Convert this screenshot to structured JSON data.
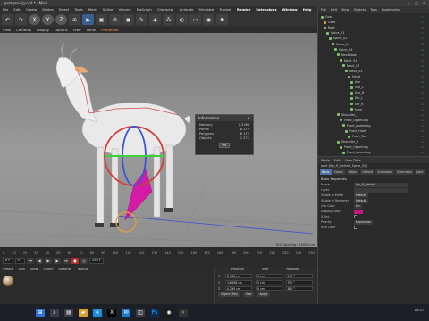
{
  "window": {
    "title": "goat-pro-rig.c4d * - Main"
  },
  "menubar": [
    "File",
    "Edit",
    "Create",
    "Modes",
    "Select",
    "Tools",
    "Mesh",
    "Spline",
    "Volume",
    "MoGraph",
    "Character",
    "Animate",
    "Simulate",
    "Tracker",
    "Render",
    "Extensions",
    "Window",
    "Help"
  ],
  "toolbar": {
    "axis_labels": [
      "X",
      "Y",
      "Z"
    ]
  },
  "viewport_menu": {
    "items": [
      "View",
      "Cameras",
      "Display",
      "Options",
      "Filter",
      "Panel",
      "ProRender"
    ],
    "active": "ProRender"
  },
  "viewport": {
    "grid_spacing": "Grid Spacing : 10000 cm"
  },
  "info_dialog": {
    "title": "Information",
    "rows": [
      {
        "label": "Memory",
        "value": "2.3 MB"
      },
      {
        "label": "Points",
        "value": "8 172"
      },
      {
        "label": "Polygons",
        "value": "8 172"
      },
      {
        "label": "Objects",
        "value": "1 271"
      }
    ],
    "ok": "OK"
  },
  "timeline": {
    "ticks": [
      "0",
      "10",
      "20",
      "30",
      "40",
      "50",
      "60",
      "70",
      "80",
      "90",
      "100",
      "110",
      "120",
      "130",
      "140",
      "150",
      "160",
      "170",
      "180",
      "190",
      "200",
      "210",
      "220",
      "230",
      "240",
      "250"
    ],
    "start": "0 F",
    "end": "250 F",
    "current": "0 F"
  },
  "material_panel": {
    "menus": [
      "Create",
      "Edit",
      "View",
      "Select",
      "Material",
      "Texture"
    ]
  },
  "coordinates": {
    "headers": [
      "Position",
      "Size",
      "Rotation"
    ],
    "rows": [
      {
        "axis": "X",
        "pos": "2.766 cm",
        "size": "0 cm",
        "rot": "H 0 °"
      },
      {
        "axis": "Y",
        "pos": "24.698 cm",
        "size": "0 cm",
        "rot": "P 0 °"
      },
      {
        "axis": "Z",
        "pos": "0.290 cm",
        "size": "0 cm",
        "rot": "B 0 °"
      }
    ],
    "mode": "Object (Rel)",
    "size_mode": "Size",
    "apply": "Apply"
  },
  "object_manager": {
    "menus": [
      "File",
      "Edit",
      "View",
      "Objects",
      "Tags",
      "Bookmarks"
    ],
    "items": [
      {
        "name": "Goat",
        "depth": 0,
        "icon": "joint"
      },
      {
        "name": "Goat",
        "depth": 1,
        "icon": "mesh"
      },
      {
        "name": "Root",
        "depth": 1,
        "icon": "joint"
      },
      {
        "name": "Spine_01",
        "depth": 2,
        "icon": "joint"
      },
      {
        "name": "Spine_02",
        "depth": 3,
        "icon": "joint"
      },
      {
        "name": "Spine_03",
        "depth": 4,
        "icon": "joint"
      },
      {
        "name": "Spine_04",
        "depth": 5,
        "icon": "joint"
      },
      {
        "name": "NeckBase",
        "depth": 6,
        "icon": "joint"
      },
      {
        "name": "Neck_01",
        "depth": 7,
        "icon": "joint"
      },
      {
        "name": "Neck_02",
        "depth": 8,
        "icon": "joint"
      },
      {
        "name": "Neck_03",
        "depth": 9,
        "icon": "joint"
      },
      {
        "name": "Head",
        "depth": 10,
        "icon": "joint"
      },
      {
        "name": "Jaw",
        "depth": 11,
        "icon": "joint"
      },
      {
        "name": "Eye_L",
        "depth": 11,
        "icon": "joint"
      },
      {
        "name": "Eye_R",
        "depth": 11,
        "icon": "joint"
      },
      {
        "name": "Ear_L",
        "depth": 11,
        "icon": "joint"
      },
      {
        "name": "Ear_R",
        "depth": 11,
        "icon": "joint"
      },
      {
        "name": "Horn",
        "depth": 11,
        "icon": "joint"
      },
      {
        "name": "Shoulder_L",
        "depth": 6,
        "icon": "joint"
      },
      {
        "name": "Front_UpperLeg",
        "depth": 7,
        "icon": "joint"
      },
      {
        "name": "Front_LowerLeg",
        "depth": 8,
        "icon": "joint"
      },
      {
        "name": "Front_Hoof",
        "depth": 9,
        "icon": "joint"
      },
      {
        "name": "Front_Toe",
        "depth": 10,
        "icon": "joint"
      },
      {
        "name": "Shoulder_R",
        "depth": 6,
        "icon": "joint"
      },
      {
        "name": "Front_UpperLeg",
        "depth": 7,
        "icon": "joint"
      },
      {
        "name": "Front_LowerLeg",
        "depth": 8,
        "icon": "joint"
      }
    ]
  },
  "attribute_manager": {
    "menus": [
      "Mode",
      "Edit",
      "User Data"
    ],
    "object_title": "Joint [Hip_R_Behind_Spine_02]",
    "tabs": [
      "Basic",
      "Coord.",
      "Object",
      "Default",
      "Animation",
      "Symmetry",
      "Joint"
    ],
    "active_tab": "Basic",
    "section": "Basic Properties",
    "rows": [
      {
        "label": "Name",
        "value": "Hip_R_Behind",
        "kind": "text"
      },
      {
        "label": "Layer",
        "value": "",
        "kind": "text"
      },
      {
        "label": "Visible in Editor",
        "value": "Default",
        "kind": "select"
      },
      {
        "label": "Visible in Renderer",
        "value": "Default",
        "kind": "select"
      },
      {
        "label": "Use Color",
        "value": "On",
        "kind": "select"
      },
      {
        "label": "Display Color",
        "value": "",
        "kind": "swatch"
      },
      {
        "label": "X-Ray",
        "value": "",
        "kind": "check"
      },
      {
        "label": "Priority",
        "value": "Expression",
        "kind": "select"
      },
      {
        "label": "Icon Color",
        "value": "",
        "kind": "check"
      }
    ],
    "swatch_color": "#c5167f"
  },
  "taskbar": {
    "icons": [
      "windows-start-icon",
      "search-icon",
      "task-view-icon",
      "explorer-icon",
      "edge-icon",
      "x-app-icon",
      "mail-icon",
      "store-icon",
      "photoshop-icon",
      "cinema4d-icon",
      "terminal-icon"
    ],
    "clock": "14:27"
  }
}
